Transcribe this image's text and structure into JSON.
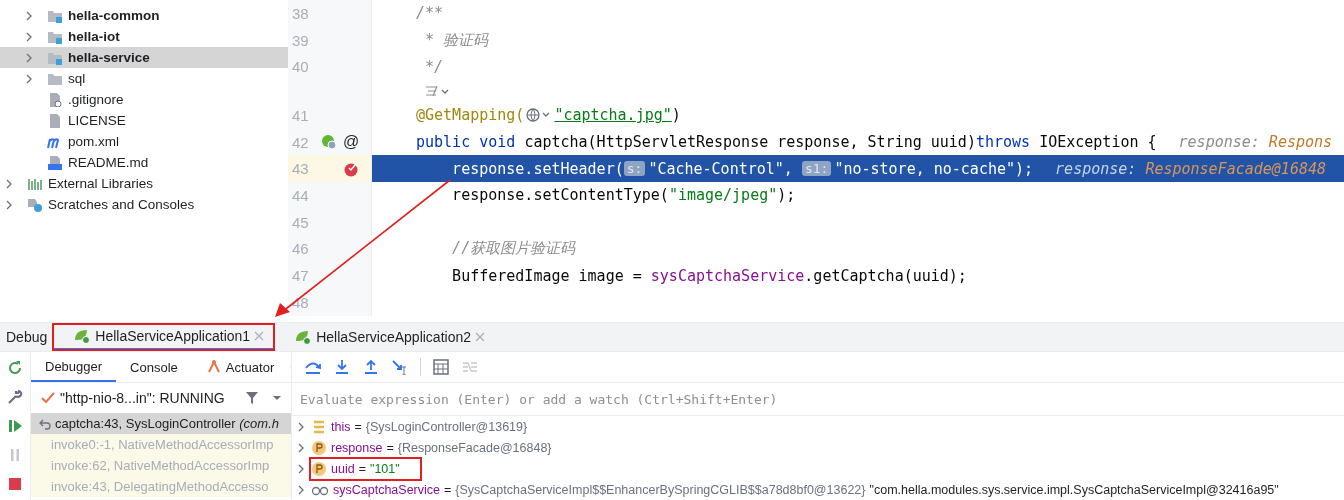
{
  "project_tree": {
    "items": [
      {
        "children": [
          {
            "label": "hella-common",
            "kind": "module",
            "expandable": true,
            "selected": false
          },
          {
            "label": "hella-iot",
            "kind": "module",
            "expandable": true,
            "selected": false
          },
          {
            "label": "hella-service",
            "kind": "module",
            "expandable": true,
            "selected": true
          },
          {
            "label": "sql",
            "kind": "folder",
            "expandable": true,
            "selected": false
          },
          {
            "label": ".gitignore",
            "kind": "ignore",
            "expandable": false,
            "selected": false
          },
          {
            "label": "LICENSE",
            "kind": "text",
            "expandable": false,
            "selected": false
          },
          {
            "label": "pom.xml",
            "kind": "maven",
            "expandable": false,
            "selected": false
          },
          {
            "label": "README.md",
            "kind": "markdown",
            "expandable": false,
            "selected": false
          }
        ]
      },
      {
        "label": "External Libraries",
        "kind": "libraries",
        "expandable": true,
        "selected": false
      },
      {
        "label": "Scratches and Consoles",
        "kind": "scratches",
        "expandable": true,
        "selected": false
      }
    ]
  },
  "editor": {
    "lines": [
      {
        "kind": "code",
        "no": "38",
        "breakpoint": false,
        "bean": false,
        "current": false,
        "tokens": [
          {
            "kind": "comment",
            "t": "/**"
          }
        ]
      },
      {
        "kind": "code",
        "no": "39",
        "breakpoint": false,
        "bean": false,
        "current": false,
        "tokens": [
          {
            "kind": "comment",
            "t": " * 验证码"
          }
        ]
      },
      {
        "kind": "code",
        "no": "40",
        "breakpoint": false,
        "bean": false,
        "current": false,
        "tokens": [
          {
            "kind": "comment",
            "t": " */"
          }
        ]
      },
      {
        "kind": "hint"
      },
      {
        "kind": "code",
        "no": "41",
        "breakpoint": false,
        "bean": false,
        "current": false,
        "tokens": [
          {
            "kind": "annotation",
            "t": "@GetMapping("
          },
          {
            "kind": "globe"
          },
          {
            "kind": "url",
            "t": "\"captcha.jpg\""
          },
          {
            "kind": "plain",
            "t": ")"
          }
        ]
      },
      {
        "kind": "code",
        "no": "42",
        "breakpoint": false,
        "bean": true,
        "gutter_text": "@",
        "current": false,
        "tokens": [
          {
            "kind": "keyword",
            "t": "public void "
          },
          {
            "kind": "plain",
            "t": "captcha(HttpServletResponse response, String uuid)"
          },
          {
            "kind": "keyword",
            "t": "throws "
          },
          {
            "kind": "plain",
            "t": "IOException {"
          },
          {
            "kind": "hint-name",
            "t": "response: "
          },
          {
            "kind": "hint-value",
            "t": "Respons"
          }
        ]
      },
      {
        "kind": "code",
        "no": "43",
        "breakpoint": true,
        "bean": false,
        "current": true,
        "tokens": [
          {
            "kind": "plain",
            "t": "    response.setHeader("
          },
          {
            "kind": "param",
            "t": "s:"
          },
          {
            "kind": "string",
            "t": "\"Cache-Control\""
          },
          {
            "kind": "plain",
            "t": ", "
          },
          {
            "kind": "param",
            "t": "s1:"
          },
          {
            "kind": "string",
            "t": "\"no-store, no-cache\""
          },
          {
            "kind": "plain",
            "t": ");"
          },
          {
            "kind": "hint-name",
            "t": "response: "
          },
          {
            "kind": "hint-value",
            "t": "ResponseFacade@16848"
          }
        ]
      },
      {
        "kind": "code",
        "no": "44",
        "breakpoint": false,
        "bean": false,
        "current": false,
        "tokens": [
          {
            "kind": "plain",
            "t": "    response.setContentType("
          },
          {
            "kind": "string",
            "t": "\"image/jpeg\""
          },
          {
            "kind": "plain",
            "t": ");"
          }
        ]
      },
      {
        "kind": "code",
        "no": "45",
        "breakpoint": false,
        "bean": false,
        "current": false
      },
      {
        "kind": "code",
        "no": "46",
        "breakpoint": false,
        "bean": false,
        "current": false,
        "tokens": [
          {
            "kind": "comment",
            "t": "    //获取图片验证码"
          }
        ]
      },
      {
        "kind": "code",
        "no": "47",
        "breakpoint": false,
        "bean": false,
        "current": false,
        "tokens": [
          {
            "kind": "plain",
            "t": "    BufferedImage image = "
          },
          {
            "kind": "field",
            "t": "sysCaptchaService"
          },
          {
            "kind": "plain",
            "t": ".getCaptcha(uuid);"
          }
        ]
      },
      {
        "kind": "code",
        "no": "48",
        "breakpoint": false,
        "bean": false,
        "current": false
      }
    ]
  },
  "debug": {
    "title": "Debug",
    "tabs": [
      {
        "label": "HellaServiceApplication1",
        "selected": true,
        "annotated": true
      },
      {
        "label": "HellaServiceApplication2",
        "selected": false,
        "annotated": false
      }
    ],
    "subtabs": [
      {
        "label": "Debugger",
        "selected": true
      },
      {
        "label": "Console",
        "selected": false
      },
      {
        "label": "Actuator",
        "selected": false
      }
    ],
    "thread": "\"http-nio-8...in\": RUNNING",
    "frames": [
      {
        "label": "captcha:43, SysLoginController *(com.h*",
        "selected": true,
        "library": false
      },
      {
        "label": "invoke0:-1, NativeMethodAccessorImp",
        "selected": false,
        "library": true
      },
      {
        "label": "invoke:62, NativeMethodAccessorImp",
        "selected": false,
        "library": true
      },
      {
        "label": "invoke:43, DelegatingMethodAccesso",
        "selected": false,
        "library": true
      }
    ],
    "evaluate": {
      "placeholder": "Evaluate expression (Enter) or add a watch (Ctrl+Shift+Enter)"
    },
    "variables": [
      {
        "kind": "this",
        "name": "this",
        "operator": "=",
        "value": "{SysLoginController@13619}",
        "annotated": false
      },
      {
        "kind": "param",
        "name": "response",
        "operator": "=",
        "value": "{ResponseFacade@16848}",
        "annotated": false
      },
      {
        "kind": "param",
        "name": "uuid",
        "operator": "=",
        "string_value": "\"101\"",
        "annotated": true
      },
      {
        "kind": "field",
        "name": "sysCaptchaService",
        "operator": "=",
        "value": "{SysCaptchaServiceImpl$$EnhancerBySpringCGLIB$$a78d8bf0@13622}",
        "string_value": "\"com.hella.modules.sys.service.impl.SysCaptchaServiceImpl@32416a95\"",
        "annotated": false
      }
    ]
  }
}
